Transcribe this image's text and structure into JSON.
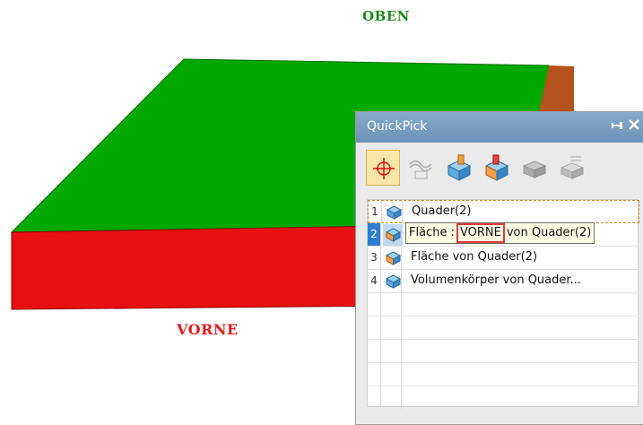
{
  "viewport": {
    "top_label": "OBEN",
    "front_label": "VORNE",
    "colors": {
      "top_face": "#00a800",
      "front_face": "#e81010",
      "side_face": "#b4521d"
    }
  },
  "quickpick": {
    "title": "QuickPick",
    "toolbar": [
      {
        "name": "select-all-icon",
        "active": true
      },
      {
        "name": "curve-filter-icon",
        "active": false
      },
      {
        "name": "body-filter-icon",
        "active": false
      },
      {
        "name": "face-filter-icon",
        "active": false
      },
      {
        "name": "solid-filter-icon",
        "active": false
      },
      {
        "name": "feature-filter-icon",
        "active": false
      }
    ],
    "items": [
      {
        "num": "1",
        "label": "Quader(2)",
        "icon": "body-icon"
      },
      {
        "num": "2",
        "label": "Fläche : VORNE von Quader(2)",
        "icon": "face-icon"
      },
      {
        "num": "3",
        "label": "Fläche von Quader(2)",
        "icon": "face-icon"
      },
      {
        "num": "4",
        "label": "Volumenkörper von Quader...",
        "icon": "solid-icon"
      }
    ],
    "tooltip": {
      "prefix": "Fläche :",
      "highlight": "VORNE",
      "suffix": "von Quader(2)"
    }
  }
}
